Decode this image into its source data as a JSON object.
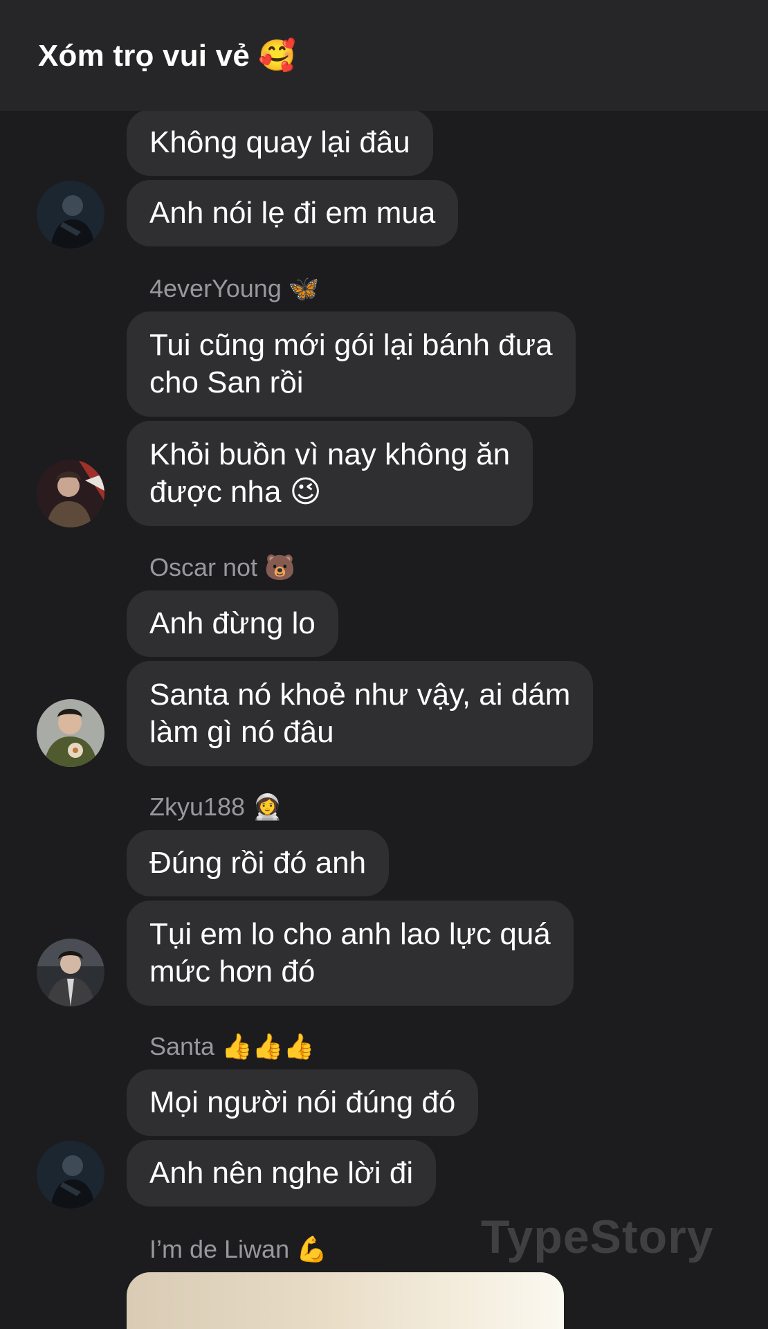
{
  "header": {
    "title": "Xóm trọ vui vẻ 🥰"
  },
  "messages": [
    {
      "text": "Không quay lại đâu"
    },
    {
      "text": "Anh nói lẹ đi em mua"
    },
    {
      "text_line1": "Tui cũng mới gói lại bánh đưa",
      "text_line2": "cho San rồi"
    },
    {
      "text_line1": "Khỏi buồn vì nay không ăn",
      "text_line2": "được nha 😉"
    },
    {
      "text": "Anh đừng lo"
    },
    {
      "text_line1": "Santa nó khoẻ như vậy, ai dám",
      "text_line2": "làm gì nó đâu"
    },
    {
      "text": "Đúng rồi đó anh"
    },
    {
      "text_line1": "Tụi em lo cho anh lao lực quá",
      "text_line2": "mức hơn đó"
    },
    {
      "text": "Mọi người nói đúng đó"
    },
    {
      "text": "Anh nên nghe lời đi"
    }
  ],
  "senders": [
    "4everYoung 🦋",
    "Oscar not 🐻",
    "Zkyu188 👩‍🚀",
    "Santa 👍👍👍",
    "I’m de Liwan 💪"
  ],
  "avatars": [
    {
      "icon": "avatar-dark-portrait",
      "bg": "#1b2630"
    },
    {
      "icon": "avatar-red-portrait",
      "bg": "#7a2a24"
    },
    {
      "icon": "avatar-green-hoodie",
      "bg": "#8b8f8a"
    },
    {
      "icon": "avatar-grey-portrait",
      "bg": "#3a3d42"
    },
    {
      "icon": "avatar-dark-portrait",
      "bg": "#1b2630"
    }
  ],
  "watermark": "TypeStory"
}
